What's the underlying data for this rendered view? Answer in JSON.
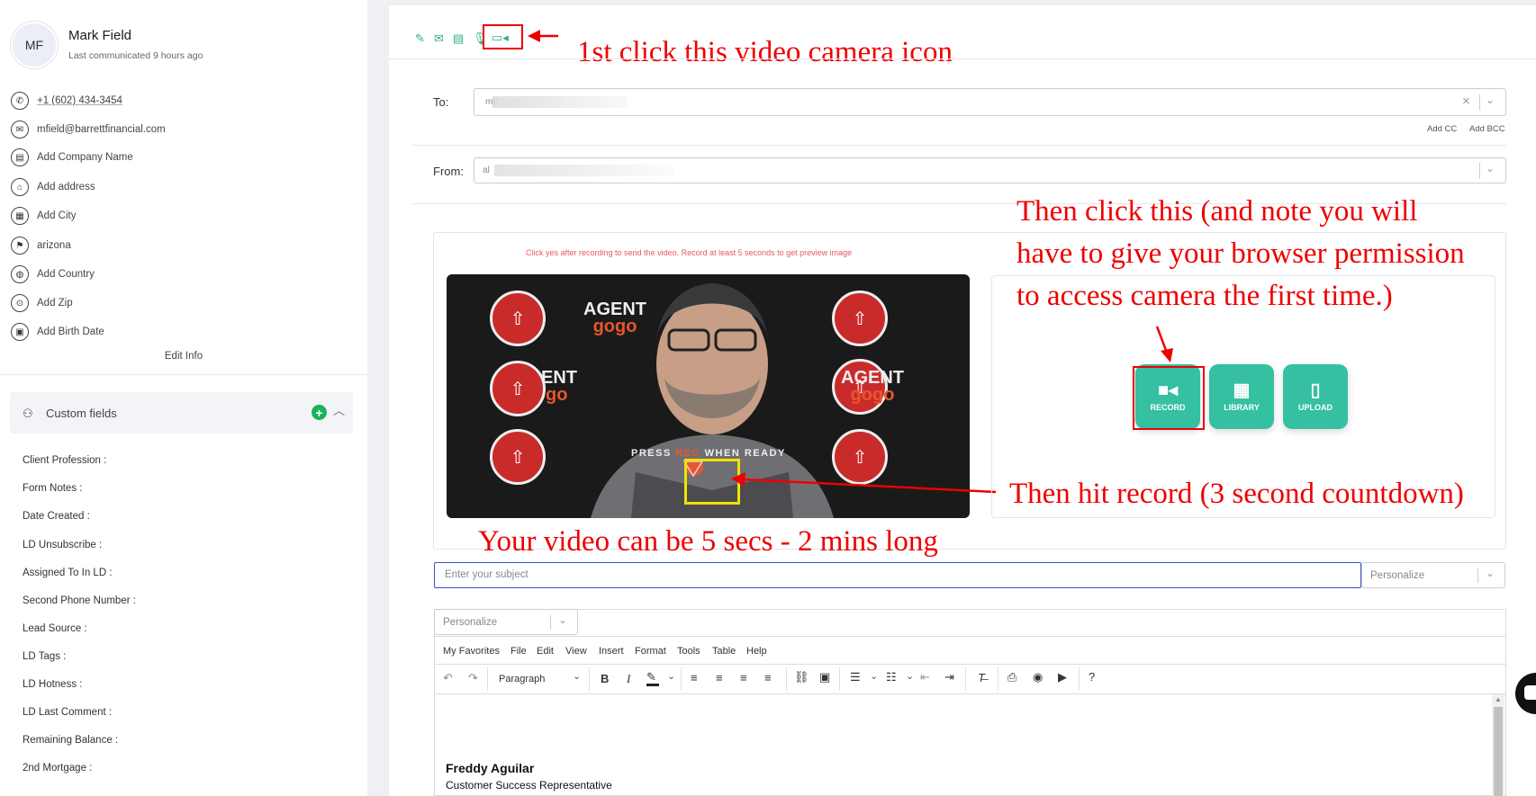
{
  "contact": {
    "initials": "MF",
    "name": "Mark Field",
    "last_communicated": "Last communicated 9 hours ago",
    "phone": "+1 (602) 434-3454",
    "email": "mfield@barrettfinancial.com",
    "company": "Add Company Name",
    "address": "Add address",
    "city": "Add City",
    "state": "arizona",
    "country": "Add Country",
    "zip": "Add Zip",
    "birth_date": "Add Birth Date",
    "edit_info": "Edit Info"
  },
  "custom_fields": {
    "title": "Custom fields",
    "items": [
      "Client Profession :",
      "Form Notes :",
      "Date Created :",
      "LD Unsubscribe :",
      "Assigned To In LD :",
      "Second Phone Number :",
      "Lead Source :",
      "LD Tags :",
      "LD Hotness :",
      "LD Last Comment :",
      "Remaining Balance :",
      "2nd Mortgage :"
    ]
  },
  "compose": {
    "to_label": "To:",
    "to_value": "mfi",
    "add_cc": "Add CC",
    "add_bcc": "Add BCC",
    "from_label": "From:",
    "from_value": "al",
    "video_hint": "Click yes after recording to send the video. Record at least 5 seconds to get preview image",
    "press_rec": "PRESS REC WHEN READY",
    "press_rec_highlight": "REC",
    "subject_placeholder": "Enter your subject",
    "personalize": "Personalize",
    "personalize_body": "Personalize"
  },
  "video_buttons": [
    {
      "label": "RECORD",
      "icon": "video-camera-icon"
    },
    {
      "label": "LIBRARY",
      "icon": "film-icon"
    },
    {
      "label": "UPLOAD",
      "icon": "file-upload-icon"
    }
  ],
  "video_logo": {
    "line1": "AGENT",
    "line2": "gogo"
  },
  "editor": {
    "menu": [
      "My Favorites",
      "File",
      "Edit",
      "View",
      "Insert",
      "Format",
      "Tools",
      "Table",
      "Help"
    ],
    "block_format": "Paragraph",
    "signature_name": "Freddy Aguilar",
    "signature_title": "Customer Success Representative"
  },
  "annotations": {
    "step1": "1st click this video camera icon",
    "step2_line1": "Then click this (and note you will",
    "step2_line2": "have to give your browser permission",
    "step2_line3": "to access camera the first time.)",
    "step3": "Then hit record (3 second countdown)",
    "length_note": "Your video can be 5 secs - 2 mins long"
  },
  "colors": {
    "accent_green": "#35c0a2",
    "annotation_red": "#e00000",
    "highlight_yellow": "#f2e200",
    "rec_orange": "#e8562e"
  }
}
